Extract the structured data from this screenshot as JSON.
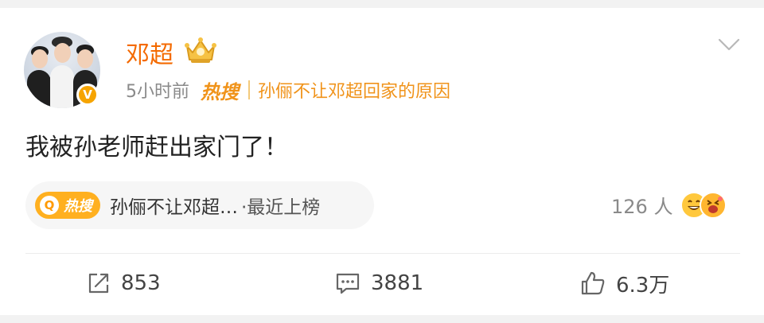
{
  "post": {
    "username": "邓超",
    "meta": {
      "time": "5小时前",
      "hot_tag": "热搜",
      "topic": "孙俪不让邓超回家的原因"
    },
    "content": "我被孙老师赶出家门了！",
    "hot_search": {
      "badge_icon_letter": "Q",
      "badge_label": "热搜",
      "topic": "孙俪不让邓超…",
      "status": "·最近上榜"
    },
    "reactions": {
      "count": "126 人",
      "emojis": [
        "grinning-face-emoji",
        "laughing-squint-face-emoji"
      ]
    },
    "actions": {
      "repost": "853",
      "comment": "3881",
      "like": "6.3万"
    },
    "avatar": {
      "badge": "V"
    }
  },
  "colors": {
    "username": "#f46a00",
    "hot_orange": "#f0931a",
    "badge_bg": "#ffb020",
    "meta_gray": "#8a8a8a",
    "background_band": "#f2f2f2"
  },
  "icons": [
    "crown-icon",
    "chevron-down-icon",
    "verified-badge-icon",
    "repost-icon",
    "comment-icon",
    "like-icon",
    "hot-search-icon"
  ]
}
